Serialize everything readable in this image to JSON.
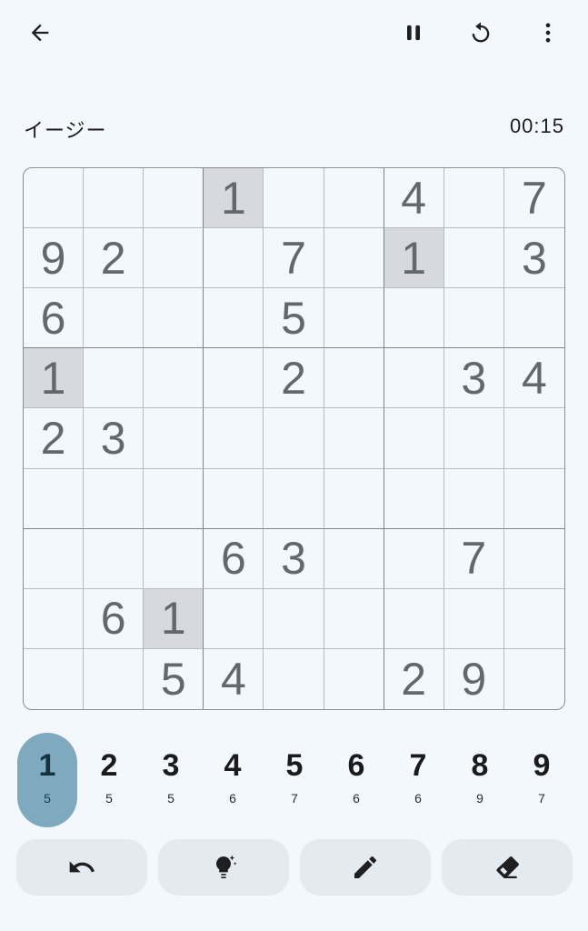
{
  "header": {
    "back_icon": "arrow-left-icon",
    "pause_icon": "pause-icon",
    "restart_icon": "restart-icon",
    "menu_icon": "more-vertical-icon"
  },
  "status": {
    "difficulty": "イージー",
    "timer": "00:15"
  },
  "board": {
    "rows": [
      [
        "",
        "",
        "",
        "1",
        "",
        "",
        "4",
        "",
        "7"
      ],
      [
        "9",
        "2",
        "",
        "",
        "7",
        "",
        "1",
        "",
        "3"
      ],
      [
        "6",
        "",
        "",
        "",
        "5",
        "",
        "",
        "",
        ""
      ],
      [
        "1",
        "",
        "",
        "",
        "2",
        "",
        "",
        "3",
        "4"
      ],
      [
        "2",
        "3",
        "",
        "",
        "",
        "",
        "",
        "",
        ""
      ],
      [
        "",
        "",
        "",
        "",
        "",
        "",
        "",
        "",
        ""
      ],
      [
        "",
        "",
        "",
        "6",
        "3",
        "",
        "",
        "7",
        ""
      ],
      [
        "",
        "6",
        "1",
        "",
        "",
        "",
        "",
        "",
        ""
      ],
      [
        "",
        "",
        "5",
        "4",
        "",
        "",
        "2",
        "9",
        ""
      ]
    ],
    "highlight_color": "#d6dade",
    "highlighted_value": "1"
  },
  "numpad": {
    "selected": "1",
    "keys": [
      {
        "digit": "1",
        "count": "5"
      },
      {
        "digit": "2",
        "count": "5"
      },
      {
        "digit": "3",
        "count": "5"
      },
      {
        "digit": "4",
        "count": "6"
      },
      {
        "digit": "5",
        "count": "7"
      },
      {
        "digit": "6",
        "count": "6"
      },
      {
        "digit": "7",
        "count": "6"
      },
      {
        "digit": "8",
        "count": "9"
      },
      {
        "digit": "9",
        "count": "7"
      }
    ],
    "accent_color": "#7fa9be"
  },
  "tools": {
    "undo_icon": "undo-icon",
    "hint_icon": "lightbulb-icon",
    "pencil_icon": "pencil-icon",
    "eraser_icon": "eraser-icon"
  }
}
